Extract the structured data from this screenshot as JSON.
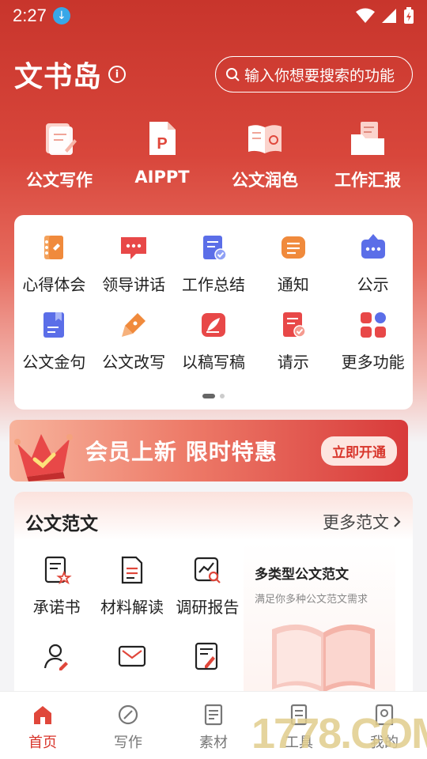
{
  "status": {
    "time": "2:27"
  },
  "header": {
    "title": "文书岛",
    "search_placeholder": "输入你想要搜索的功能"
  },
  "top_tools": [
    {
      "label": "公文写作",
      "icon": "notebook-pen-icon"
    },
    {
      "label": "AIPPT",
      "icon": "ppt-file-icon"
    },
    {
      "label": "公文润色",
      "icon": "open-book-icon"
    },
    {
      "label": "工作汇报",
      "icon": "folder-doc-icon"
    }
  ],
  "grid": {
    "rows": [
      [
        {
          "label": "心得体会",
          "icon": "notebook-icon",
          "color": "#f08a3c"
        },
        {
          "label": "领导讲话",
          "icon": "chat-bubble-icon",
          "color": "#e84848"
        },
        {
          "label": "工作总结",
          "icon": "doc-check-icon",
          "color": "#5b6ee8"
        },
        {
          "label": "通知",
          "icon": "message-lines-icon",
          "color": "#f08a3c"
        },
        {
          "label": "公示",
          "icon": "board-icon",
          "color": "#5b6ee8"
        }
      ],
      [
        {
          "label": "公文金句",
          "icon": "bookmark-doc-icon",
          "color": "#5b6ee8"
        },
        {
          "label": "公文改写",
          "icon": "fountain-pen-icon",
          "color": "#f08a3c"
        },
        {
          "label": "以稿写稿",
          "icon": "quill-icon",
          "color": "#e84848"
        },
        {
          "label": "请示",
          "icon": "doc-approve-icon",
          "color": "#e84848"
        },
        {
          "label": "更多功能",
          "icon": "grid-more-icon",
          "color": "#e84848"
        }
      ]
    ]
  },
  "vip": {
    "text": "会员上新 限时特惠",
    "button": "立即开通"
  },
  "samples": {
    "title": "公文范文",
    "more": "更多范文",
    "items": [
      {
        "label": "承诺书",
        "icon": "doc-star-icon"
      },
      {
        "label": "材料解读",
        "icon": "doc-lines-icon"
      },
      {
        "label": "调研报告",
        "icon": "chart-search-icon"
      },
      {
        "label": "",
        "icon": "user-edit-icon"
      },
      {
        "label": "",
        "icon": "envelope-icon"
      },
      {
        "label": "",
        "icon": "doc-pen-icon"
      }
    ],
    "promo_title": "多类型公文范文",
    "promo_sub": "满足你多种公文范文需求"
  },
  "tabs": [
    {
      "label": "首页",
      "icon": "home-icon",
      "active": true
    },
    {
      "label": "写作",
      "icon": "compass-icon",
      "active": false
    },
    {
      "label": "素材",
      "icon": "doc-list-icon",
      "active": false
    },
    {
      "label": "工具",
      "icon": "tool-icon",
      "active": false
    },
    {
      "label": "我的",
      "icon": "profile-icon",
      "active": false
    }
  ],
  "watermark": "1778.COM"
}
